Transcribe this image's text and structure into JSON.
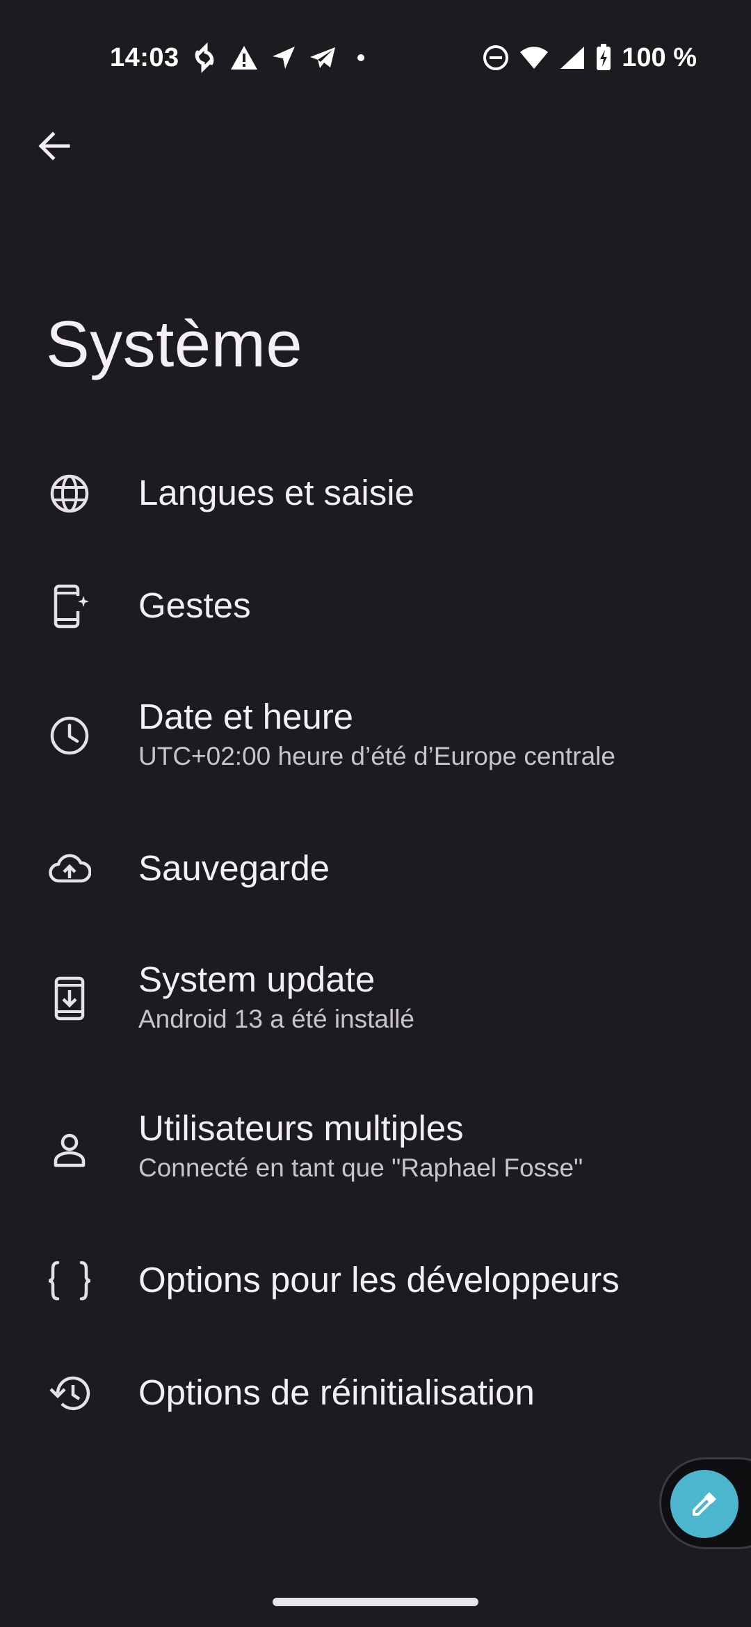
{
  "status_bar": {
    "time": "14:03",
    "battery_text": "100 %",
    "left_icons": [
      "sync-icon",
      "warning-icon",
      "location-arrow-icon",
      "telegram-icon",
      "dot-icon"
    ],
    "right_icons": [
      "do-not-disturb-icon",
      "wifi-icon",
      "signal-icon",
      "battery-charging-icon"
    ]
  },
  "header": {
    "back_icon": "arrow-back-icon",
    "title": "Système"
  },
  "settings": {
    "items": [
      {
        "icon": "globe-icon",
        "title": "Langues et saisie",
        "subtitle": ""
      },
      {
        "icon": "phone-gesture-icon",
        "title": "Gestes",
        "subtitle": ""
      },
      {
        "icon": "clock-icon",
        "title": "Date et heure",
        "subtitle": "UTC+02:00 heure d’été d’Europe centrale"
      },
      {
        "icon": "cloud-upload-icon",
        "title": "Sauvegarde",
        "subtitle": ""
      },
      {
        "icon": "system-update-icon",
        "title": "System update",
        "subtitle": "Android 13 a été installé"
      },
      {
        "icon": "person-icon",
        "title": "Utilisateurs multiples",
        "subtitle": "Connecté en tant que \"Raphael Fosse\""
      },
      {
        "icon": "code-braces-icon",
        "title": "Options pour les développeurs",
        "subtitle": ""
      },
      {
        "icon": "history-icon",
        "title": "Options de réinitialisation",
        "subtitle": ""
      }
    ]
  },
  "fab": {
    "icon": "color-picker-icon",
    "color": "#4db6cf"
  },
  "theme": {
    "background": "#1b1b20",
    "text_primary": "#f4eff4",
    "text_secondary": "#c9c4cb"
  }
}
